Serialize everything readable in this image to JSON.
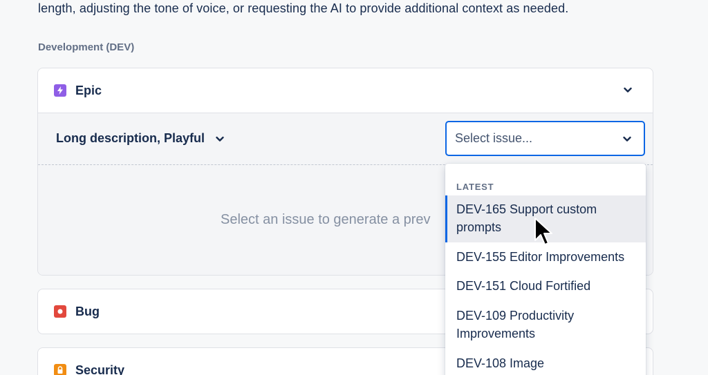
{
  "intro": {
    "text": "length, adjusting the tone of voice, or requesting the AI to provide additional context as needed."
  },
  "project": {
    "section_title": "Development (DEV)"
  },
  "issue_types": [
    {
      "label": "Epic",
      "icon": "lightning-icon",
      "color": "#8f5ee6"
    },
    {
      "label": "Bug",
      "icon": "bug-icon",
      "color": "#e2483d"
    },
    {
      "label": "Security",
      "icon": "lock-icon",
      "color": "#f18d13"
    }
  ],
  "epic_panel": {
    "tone_label": "Long description, Playful",
    "issue_select_placeholder": "Select issue...",
    "preview_placeholder": "Select an issue to generate a prev"
  },
  "dropdown": {
    "heading": "LATEST",
    "options": [
      {
        "label": "DEV-165 Support custom prompts",
        "selected": true
      },
      {
        "label": "DEV-155 Editor Improvements",
        "selected": false
      },
      {
        "label": "DEV-151 Cloud Fortified",
        "selected": false
      },
      {
        "label": "DEV-109 Productivity Improvements",
        "selected": false
      },
      {
        "label": "DEV-108 Image",
        "selected": false
      }
    ]
  },
  "colors": {
    "accent": "#0c66e4",
    "epic": "#8f5ee6",
    "bug": "#e2483d",
    "security": "#f18d13"
  }
}
